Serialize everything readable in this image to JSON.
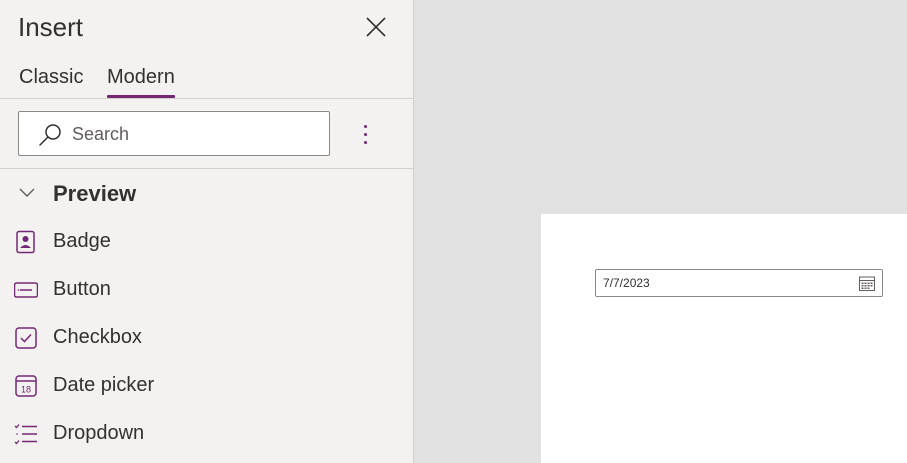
{
  "panel": {
    "title": "Insert",
    "tabs": [
      {
        "label": "Classic",
        "active": false
      },
      {
        "label": "Modern",
        "active": true
      }
    ],
    "search": {
      "placeholder": "Search",
      "value": ""
    },
    "section": {
      "label": "Preview",
      "expanded": true
    },
    "items": [
      {
        "label": "Badge",
        "icon": "badge-icon"
      },
      {
        "label": "Button",
        "icon": "button-icon"
      },
      {
        "label": "Checkbox",
        "icon": "checkbox-icon"
      },
      {
        "label": "Date picker",
        "icon": "date-picker-icon"
      },
      {
        "label": "Dropdown",
        "icon": "dropdown-icon"
      }
    ]
  },
  "canvas": {
    "date_picker": {
      "value": "7/7/2023",
      "icon": "calendar-icon"
    }
  },
  "colors": {
    "accent": "#742774",
    "panel_bg": "#f3f2f1",
    "canvas_bg": "#e1e1e1",
    "screen_bg": "#ffffff"
  }
}
